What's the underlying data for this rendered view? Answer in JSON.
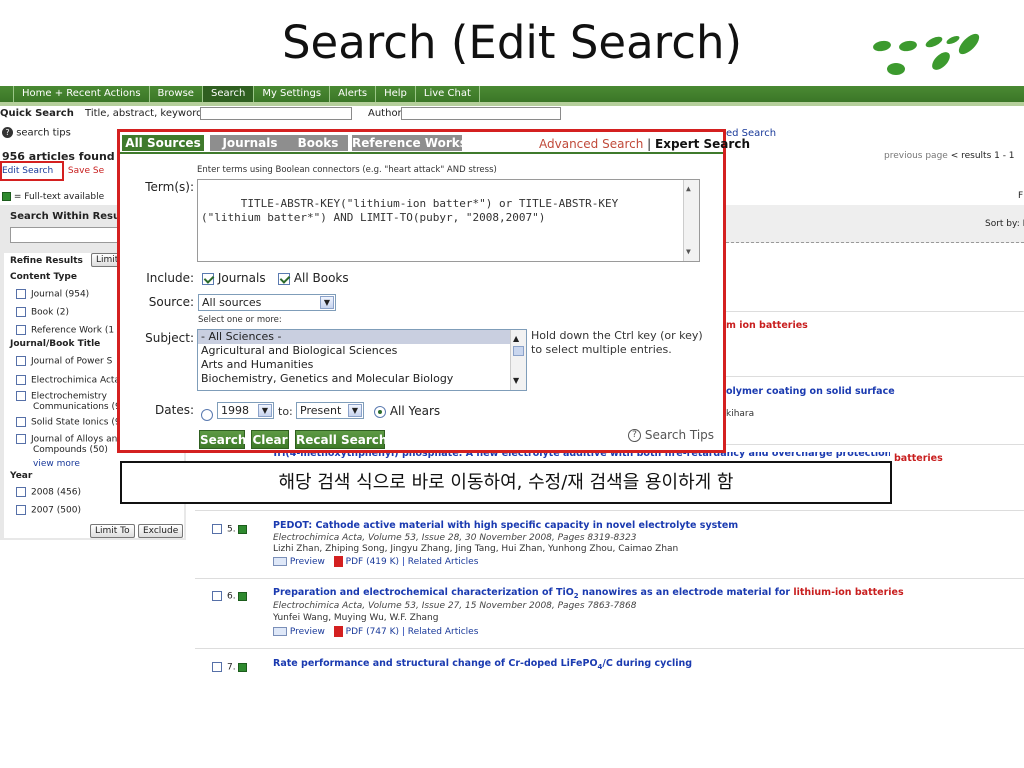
{
  "slide_title": "Search (Edit Search)",
  "nav": {
    "items": [
      "Home + Recent Actions",
      "Browse",
      "Search",
      "My Settings",
      "Alerts",
      "Help",
      "Live Chat"
    ],
    "active_index": 2
  },
  "quick_search": {
    "label": "Quick Search",
    "field1_label": "Title, abstract, keywords",
    "author_label": "Author",
    "search_tips": "search tips",
    "advanced_search_link": "ed Search"
  },
  "results_header": {
    "count_text": "956 articles found",
    "edit_search": "Edit Search",
    "save_search_partial": "Save Se",
    "fulltext_legend": "= Full-text available",
    "previous_page": "previous page",
    "results_range": "< results 1 - 1",
    "sort_by": "Sort by: I",
    "right_f": "F"
  },
  "sidebar": {
    "search_within": "Search Within Result",
    "refine_results": "Refine Results",
    "limit_btn_partial": "Limit",
    "content_type_heading": "Content Type",
    "content_types": [
      "Journal (954)",
      "Book (2)",
      "Reference Work (1"
    ],
    "journal_heading": "Journal/Book Title",
    "journals": [
      "Journal of Power S",
      "Electrochimica Acta",
      "Electrochemistry",
      "Communications (96",
      "Solid State Ionics (9",
      "Journal of Alloys an",
      "Compounds (50)"
    ],
    "view_more": "view more",
    "year_heading": "Year",
    "years": [
      "2008 (456)",
      "2007 (500)"
    ],
    "limit_to": "Limit To",
    "exclude": "Exclude"
  },
  "partial_results": {
    "r2_tail": "m ion batteries",
    "r3_tail": "olymer coating on solid surface",
    "r3_author_tail": "kihara",
    "r4_tail": "batteries"
  },
  "results": [
    {
      "num": "5.",
      "title": "PEDOT: Cathode active material with high specific capacity in novel electrolyte system",
      "meta": "Electrochimica Acta, Volume 53, Issue 28, 30 November 2008, Pages 8319-8323",
      "authors": "Lizhi Zhan, Zhiping Song, Jingyu Zhang, Jing Tang, Hui Zhan, Yunhong Zhou, Caimao Zhan",
      "preview": "Preview",
      "pdf": "PDF (419 K)",
      "related": "Related Articles"
    },
    {
      "num": "6.",
      "title_part1": "Preparation and electrochemical characterization of TiO",
      "title_sub": "2",
      "title_part2": " nanowires as an electrode material for ",
      "title_red": "lithium-ion batteries",
      "meta": "Electrochimica Acta, Volume 53, Issue 27, 15 November 2008, Pages 7863-7868",
      "authors": "Yunfei Wang, Muying Wu, W.F. Zhang",
      "preview": "Preview",
      "pdf": "PDF (747 K)",
      "related": "Related Articles"
    },
    {
      "num": "7.",
      "title_part1": "Rate performance and structural change of Cr-doped LiFePO",
      "title_sub": "4",
      "title_part2": "/C during cycling"
    }
  ],
  "dialog": {
    "tabs": [
      "All Sources",
      "Journals",
      "Books",
      "Reference Works"
    ],
    "active_tab": 0,
    "advanced_search": "Advanced Search",
    "separator": "|",
    "expert_search": "Expert Search",
    "hint": "Enter terms using Boolean connectors (e.g. \"heart attack\" AND stress)",
    "terms_label": "Term(s):",
    "terms_value": "TITLE-ABSTR-KEY(\"lithium-ion batter*\") or TITLE-ABSTR-KEY\n(\"lithium batter*\") AND LIMIT-TO(pubyr, \"2008,2007\")",
    "include_label": "Include:",
    "include_journals": "Journals",
    "include_books": "All Books",
    "source_label": "Source:",
    "source_value": "All sources",
    "select_hint": "Select one or more:",
    "subject_label": "Subject:",
    "subjects": [
      "- All Sciences -",
      "Agricultural and Biological Sciences",
      "Arts and Humanities",
      "Biochemistry, Genetics and Molecular Biology"
    ],
    "ctrl_hint_line1": "Hold down the Ctrl key (or      key)",
    "ctrl_hint_line2": "to select multiple entries.",
    "dates_label": "Dates:",
    "from_year": "1998",
    "to_label": "to:",
    "to_year": "Present",
    "all_years": "All Years",
    "search_btn": "Search",
    "clear_btn": "Clear",
    "recall_btn": "Recall Search",
    "search_tips": "Search Tips"
  },
  "callout_text": "해당 검색 식으로 바로 이동하여, 수정/재 검색을 용이하게 함",
  "colors": {
    "nav_green": "#3b7627",
    "highlight_red": "#d42020",
    "link_blue": "#1a3ab0"
  }
}
